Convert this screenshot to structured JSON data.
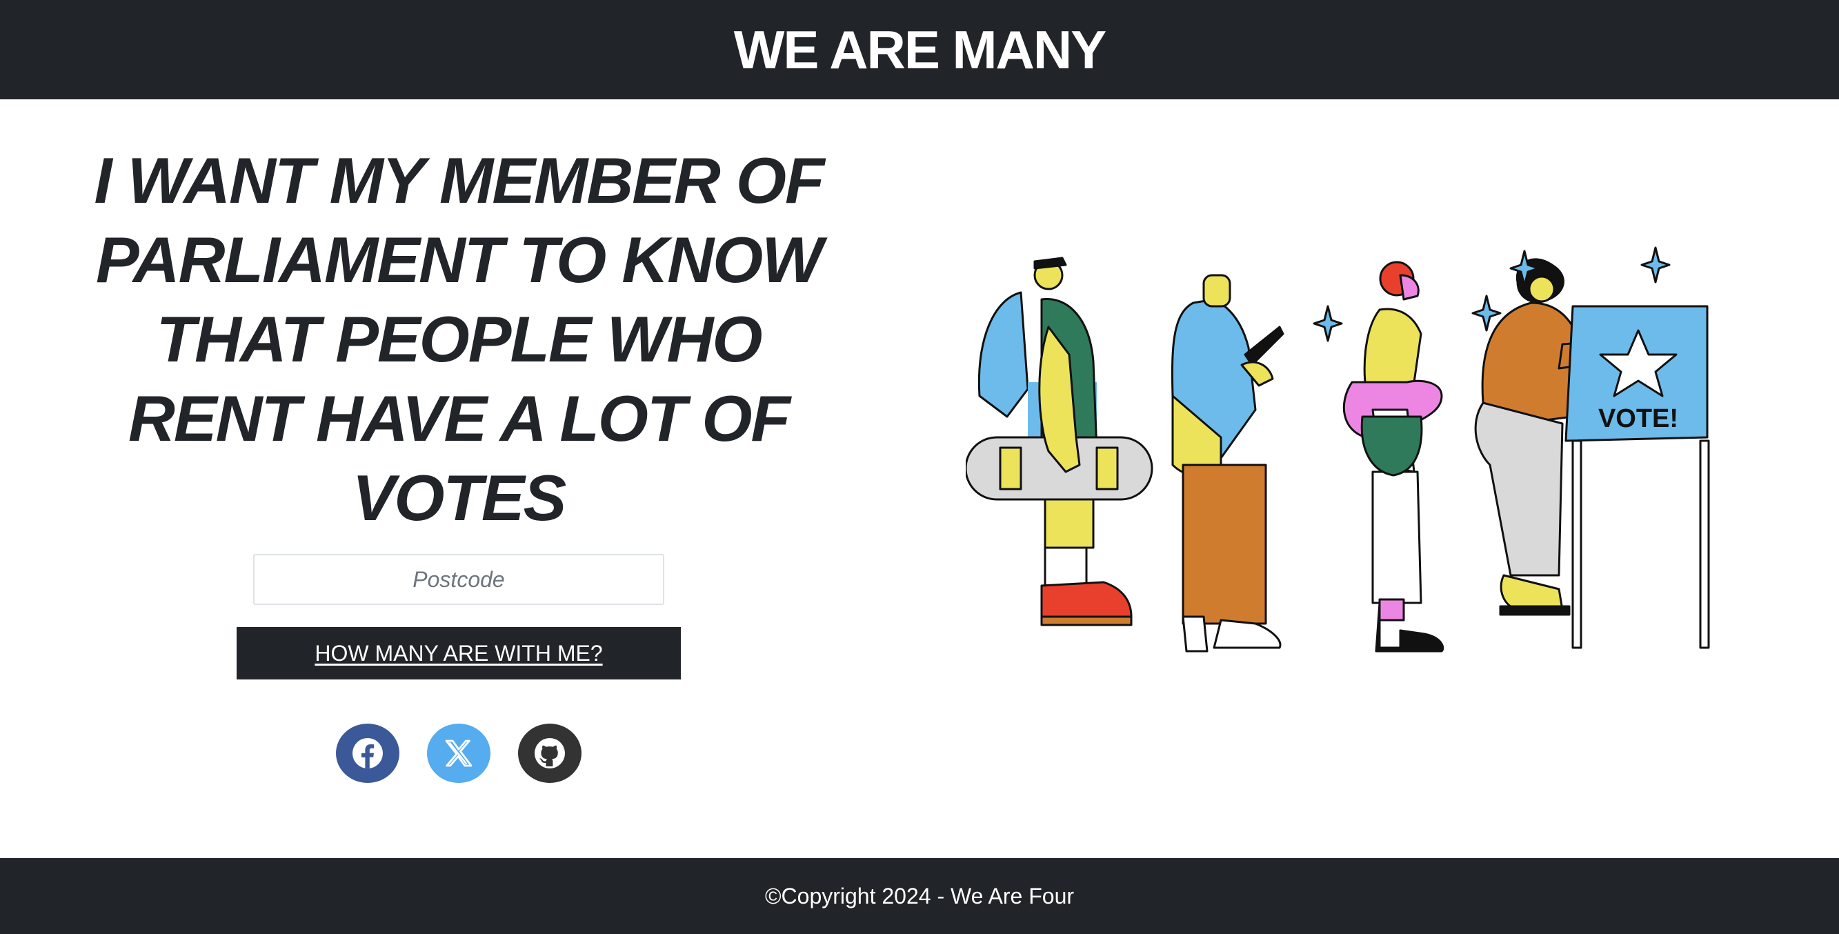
{
  "header": {
    "brand": "WE ARE MANY"
  },
  "main": {
    "headline": "I WANT MY MEMBER OF PARLIAMENT TO KNOW THAT PEOPLE WHO RENT HAVE A LOT OF VOTES",
    "postcode_placeholder": "Postcode",
    "postcode_value": "",
    "cta_label": "HOW MANY ARE WITH ME?",
    "illustration_sign_text": "VOTE!"
  },
  "socials": [
    {
      "name": "facebook",
      "icon": "facebook-icon",
      "color": "#3b5998"
    },
    {
      "name": "x",
      "icon": "x-icon",
      "color": "#55acee"
    },
    {
      "name": "github",
      "icon": "github-icon",
      "color": "#333333"
    }
  ],
  "footer": {
    "copyright": "©Copyright 2024 - We Are Four"
  },
  "colors": {
    "dark": "#212529",
    "white": "#ffffff"
  }
}
